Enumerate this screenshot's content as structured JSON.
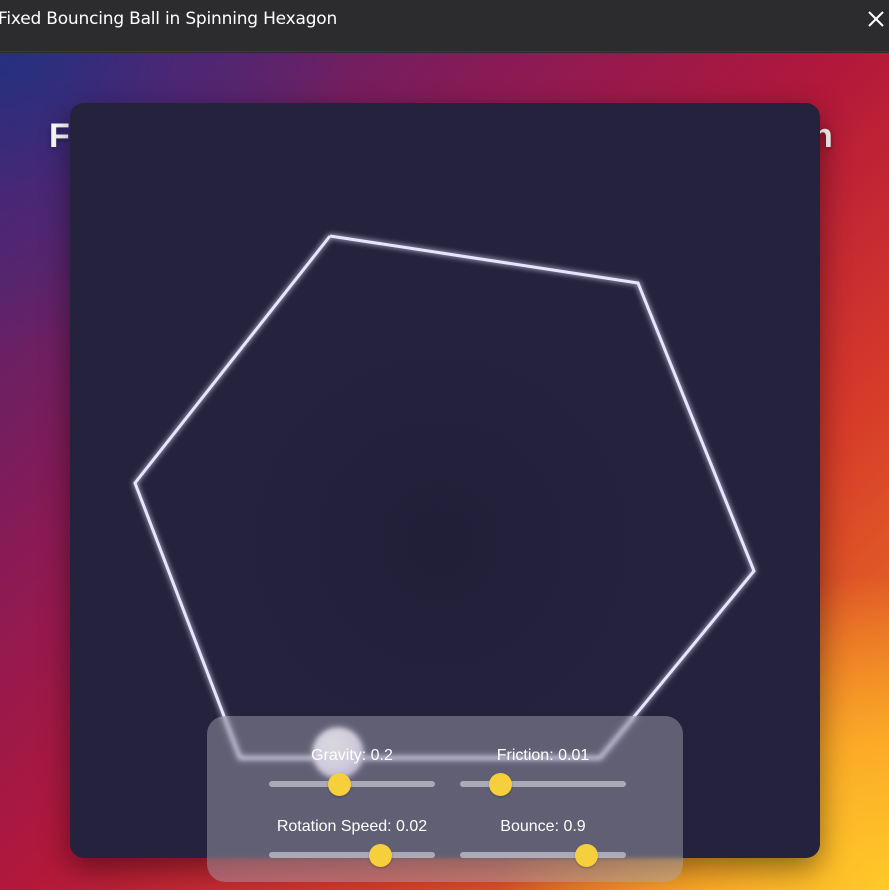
{
  "window": {
    "title": "Fixed Bouncing Ball in Spinning Hexagon",
    "close_icon": "close-icon"
  },
  "page": {
    "heading_left": "F",
    "heading_right": "n"
  },
  "controls": [
    {
      "id": "gravity",
      "label": "Gravity: 0.2",
      "value_fraction": 0.42
    },
    {
      "id": "friction",
      "label": "Friction: 0.01",
      "value_fraction": 0.24
    },
    {
      "id": "rotation",
      "label": "Rotation Speed: 0.02",
      "value_fraction": 0.67
    },
    {
      "id": "bounce",
      "label": "Bounce: 0.9",
      "value_fraction": 0.76
    }
  ],
  "colors": {
    "panel": "#24223d",
    "hexagon_stroke": "#e8e4ff",
    "ball": "#f4eefc",
    "slider_thumb": "#f6cf3d"
  }
}
